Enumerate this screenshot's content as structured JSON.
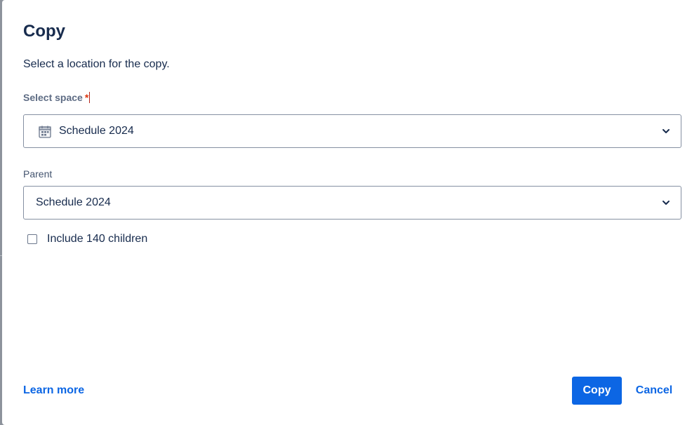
{
  "dialog": {
    "title": "Copy",
    "subtitle": "Select a location for the copy."
  },
  "space_field": {
    "label": "Select space",
    "required_mark": "*",
    "value": "Schedule 2024",
    "icon": "calendar-icon"
  },
  "parent_field": {
    "label": "Parent",
    "value": "Schedule 2024"
  },
  "include_children": {
    "label": "Include 140 children",
    "checked": false
  },
  "footer": {
    "learn_more": "Learn more",
    "copy_label": "Copy",
    "cancel_label": "Cancel"
  },
  "colors": {
    "primary": "#0c66e4",
    "text": "#172b4d",
    "required": "#de350b"
  }
}
